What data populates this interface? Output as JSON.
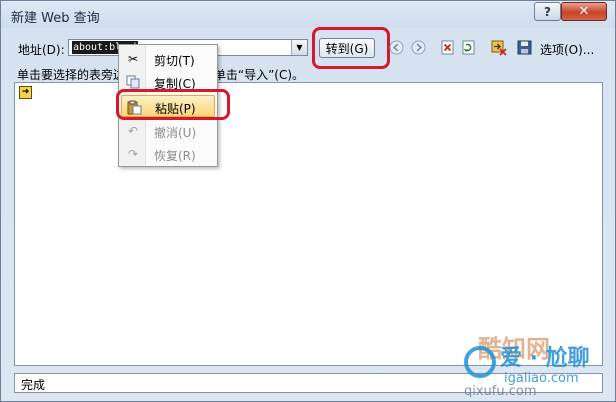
{
  "window": {
    "title": "新建 Web 查询",
    "help_label": "?",
    "close_label": "✕"
  },
  "toolbar": {
    "address_label": "地址(D):",
    "address_value": "about:blank",
    "go_label": "转到(G)",
    "options_label": "选项(O)...",
    "icons": [
      "back-icon",
      "forward-icon",
      "stop-icon",
      "refresh-icon",
      "hide-icons-icon",
      "save-query-icon"
    ]
  },
  "instruction": {
    "text": "单击要选择的表旁边的 ▶ 箭头，然后单击“导入”(C)。"
  },
  "context_menu": {
    "items": [
      {
        "label": "剪切(T)",
        "icon": "cut-icon",
        "enabled": true
      },
      {
        "label": "复制(C)",
        "icon": "copy-icon",
        "enabled": true
      },
      {
        "label": "粘贴(P)",
        "icon": "paste-icon",
        "enabled": true
      },
      {
        "label": "撤消(U)",
        "icon": "undo-icon",
        "enabled": false
      },
      {
        "label": "恢复(R)",
        "icon": "redo-icon",
        "enabled": false
      }
    ]
  },
  "status": {
    "text": "完成"
  },
  "watermark": {
    "brand": "爱 · 尬聊",
    "domain": "igaliao.com",
    "subtext": "qixufu.com",
    "site_name": "酷知网"
  },
  "colors": {
    "highlight": "#d4182d",
    "menu_hover": "#f9d679"
  }
}
